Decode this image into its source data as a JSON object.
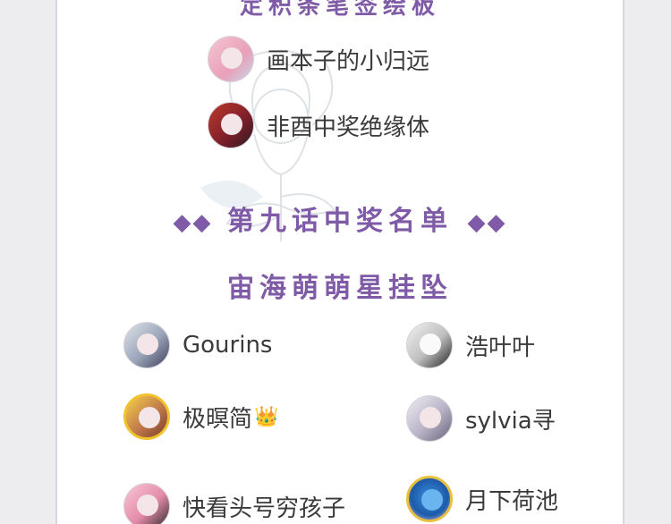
{
  "header": {
    "title": "定积条笔签绘板"
  },
  "section": {
    "diamonds_left": "◆◆",
    "title": "第九话中奖名单",
    "diamonds_right": "◆◆",
    "subtitle": "宙海萌萌星挂坠"
  },
  "top_winners": [
    {
      "name": "画本子的小归远",
      "avatar_icon": "pink-hair-girl-avatar"
    },
    {
      "name": "非酉中奖绝缘体",
      "avatar_icon": "red-hair-girl-avatar"
    }
  ],
  "winners": [
    {
      "name": "Gourins",
      "avatar_icon": "silver-hair-cap-avatar"
    },
    {
      "name": "浩叶叶",
      "avatar_icon": "sunglasses-sketch-avatar"
    },
    {
      "name": "极暝简",
      "avatar_icon": "gold-frame-avatar",
      "badge": "👑"
    },
    {
      "name": "sylvia寻",
      "avatar_icon": "sketch-girl-avatar"
    },
    {
      "name": "快看头号穷孩子",
      "avatar_icon": "pink-hair-avatar"
    },
    {
      "name": "月下荷池",
      "avatar_icon": "blue-creature-avatar"
    }
  ],
  "colors": {
    "accent": "#7f5aa6",
    "text": "#3a3a3a",
    "panel": "#ffffff",
    "backdrop": "#ededf0"
  }
}
